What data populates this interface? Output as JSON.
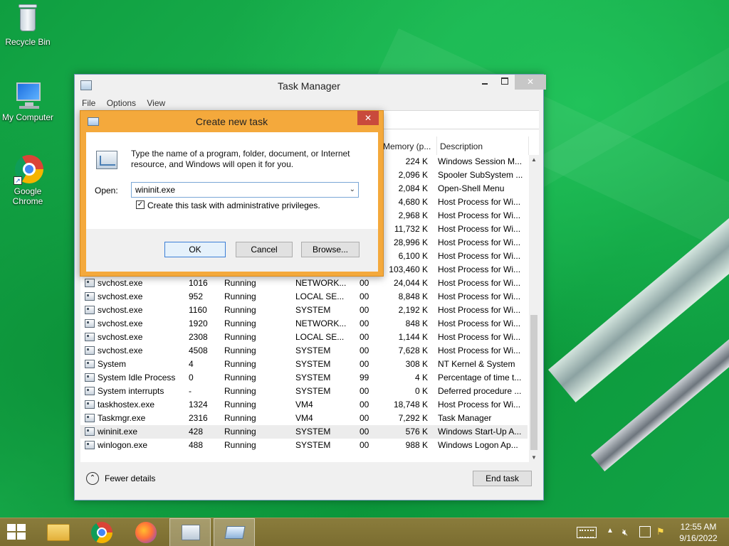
{
  "desktop": {
    "icons": [
      {
        "label": "Recycle Bin",
        "icon": "recycle-bin-icon"
      },
      {
        "label": "My Computer",
        "icon": "computer-icon"
      },
      {
        "label": "Google Chrome",
        "icon": "chrome-icon"
      }
    ]
  },
  "taskmgr": {
    "title": "Task Manager",
    "menu": [
      "File",
      "Options",
      "View"
    ],
    "columns": {
      "memory": "Memory (p...",
      "description": "Description"
    },
    "upper_rows": [
      {
        "memory": "224 K",
        "description": "Windows Session M..."
      },
      {
        "memory": "2,096 K",
        "description": "Spooler SubSystem ..."
      },
      {
        "memory": "2,084 K",
        "description": "Open-Shell Menu"
      },
      {
        "memory": "4,680 K",
        "description": "Host Process for Wi..."
      },
      {
        "memory": "2,968 K",
        "description": "Host Process for Wi..."
      },
      {
        "memory": "11,732 K",
        "description": "Host Process for Wi..."
      },
      {
        "memory": "28,996 K",
        "description": "Host Process for Wi..."
      },
      {
        "memory": "6,100 K",
        "description": "Host Process for Wi..."
      },
      {
        "memory": "103,460 K",
        "description": "Host Process for Wi..."
      }
    ],
    "rows": [
      {
        "name": "svchost.exe",
        "pid": "1016",
        "status": "Running",
        "user": "NETWORK...",
        "cpu": "00",
        "memory": "24,044 K",
        "description": "Host Process for Wi..."
      },
      {
        "name": "svchost.exe",
        "pid": "952",
        "status": "Running",
        "user": "LOCAL SE...",
        "cpu": "00",
        "memory": "8,848 K",
        "description": "Host Process for Wi..."
      },
      {
        "name": "svchost.exe",
        "pid": "1160",
        "status": "Running",
        "user": "SYSTEM",
        "cpu": "00",
        "memory": "2,192 K",
        "description": "Host Process for Wi..."
      },
      {
        "name": "svchost.exe",
        "pid": "1920",
        "status": "Running",
        "user": "NETWORK...",
        "cpu": "00",
        "memory": "848 K",
        "description": "Host Process for Wi..."
      },
      {
        "name": "svchost.exe",
        "pid": "2308",
        "status": "Running",
        "user": "LOCAL SE...",
        "cpu": "00",
        "memory": "1,144 K",
        "description": "Host Process for Wi..."
      },
      {
        "name": "svchost.exe",
        "pid": "4508",
        "status": "Running",
        "user": "SYSTEM",
        "cpu": "00",
        "memory": "7,628 K",
        "description": "Host Process for Wi..."
      },
      {
        "name": "System",
        "pid": "4",
        "status": "Running",
        "user": "SYSTEM",
        "cpu": "00",
        "memory": "308 K",
        "description": "NT Kernel & System"
      },
      {
        "name": "System Idle Process",
        "pid": "0",
        "status": "Running",
        "user": "SYSTEM",
        "cpu": "99",
        "memory": "4 K",
        "description": "Percentage of time t..."
      },
      {
        "name": "System interrupts",
        "pid": "-",
        "status": "Running",
        "user": "SYSTEM",
        "cpu": "00",
        "memory": "0 K",
        "description": "Deferred procedure ..."
      },
      {
        "name": "taskhostex.exe",
        "pid": "1324",
        "status": "Running",
        "user": "VM4",
        "cpu": "00",
        "memory": "18,748 K",
        "description": "Host Process for Wi..."
      },
      {
        "name": "Taskmgr.exe",
        "pid": "2316",
        "status": "Running",
        "user": "VM4",
        "cpu": "00",
        "memory": "7,292 K",
        "description": "Task Manager"
      },
      {
        "name": "wininit.exe",
        "pid": "428",
        "status": "Running",
        "user": "SYSTEM",
        "cpu": "00",
        "memory": "576 K",
        "description": "Windows Start-Up A..."
      },
      {
        "name": "winlogon.exe",
        "pid": "488",
        "status": "Running",
        "user": "SYSTEM",
        "cpu": "00",
        "memory": "988 K",
        "description": "Windows Logon Ap..."
      }
    ],
    "fewer_details": "Fewer details",
    "end_task": "End task"
  },
  "dialog": {
    "title": "Create new task",
    "message": "Type the name of a program, folder, document, or Internet resource, and Windows will open it for you.",
    "open_label": "Open:",
    "open_value": "wininit.exe",
    "admin_label": "Create this task with administrative privileges.",
    "admin_checked": true,
    "ok": "OK",
    "cancel": "Cancel",
    "browse": "Browse..."
  },
  "taskbar": {
    "apps": [
      "start-icon",
      "file-explorer-icon",
      "chrome-icon",
      "firefox-icon",
      "task-manager-icon",
      "run-dialog-icon"
    ],
    "time": "12:55 AM",
    "date": "9/16/2022"
  }
}
